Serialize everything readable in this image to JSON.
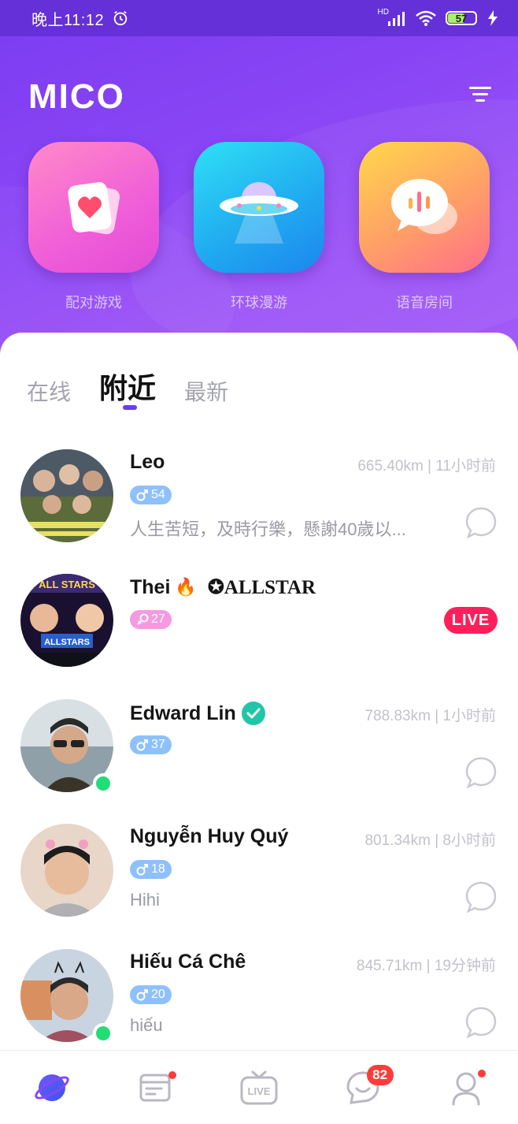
{
  "status_bar": {
    "time": "晚上11:12",
    "battery_level": "57",
    "network_label": "HD"
  },
  "header": {
    "logo": "MICO",
    "features": [
      {
        "label": "配对游戏",
        "icon": "heart-card-icon"
      },
      {
        "label": "环球漫游",
        "icon": "ufo-icon"
      },
      {
        "label": "语音房间",
        "icon": "voice-bubble-icon"
      }
    ]
  },
  "tabs": [
    {
      "label": "在线",
      "active": false
    },
    {
      "label": "附近",
      "active": true
    },
    {
      "label": "最新",
      "active": false
    }
  ],
  "users": [
    {
      "name": "Leo",
      "age": "54",
      "gender": "male",
      "meta": "665.40km | 11小时前",
      "bio": "人生苦短，及時行樂，懸謝40歲以...",
      "online": false,
      "live": false
    },
    {
      "name": "Thei",
      "name_suffix": "✪ALLSTAR",
      "age": "27",
      "gender": "female",
      "meta": "",
      "bio": "",
      "online": false,
      "live": true,
      "live_label": "LIVE"
    },
    {
      "name": "Edward Lin",
      "age": "37",
      "gender": "male",
      "meta": "788.83km | 1小时前",
      "bio": "",
      "online": true,
      "live": false,
      "verified": true
    },
    {
      "name": "Nguyễn Huy Quý",
      "age": "18",
      "gender": "male",
      "meta": "801.34km | 8小时前",
      "bio": "Hihi",
      "online": false,
      "live": false
    },
    {
      "name": "Hiếu Cá Chê",
      "age": "20",
      "gender": "male",
      "meta": "845.71km | 19分钟前",
      "bio": "hiếu",
      "online": true,
      "live": false
    }
  ],
  "bottom_nav": {
    "items": [
      {
        "icon": "planet-icon",
        "active": true
      },
      {
        "icon": "feed-icon",
        "dot": true
      },
      {
        "icon": "live-tv-icon",
        "label": "LIVE"
      },
      {
        "icon": "chat-smile-icon",
        "badge": "82"
      },
      {
        "icon": "profile-icon",
        "dot": true
      }
    ]
  },
  "colors": {
    "header_purple": "#8a45f5",
    "accent": "#6b3df0",
    "live_red": "#ff1f5a",
    "online_green": "#22dd77"
  }
}
